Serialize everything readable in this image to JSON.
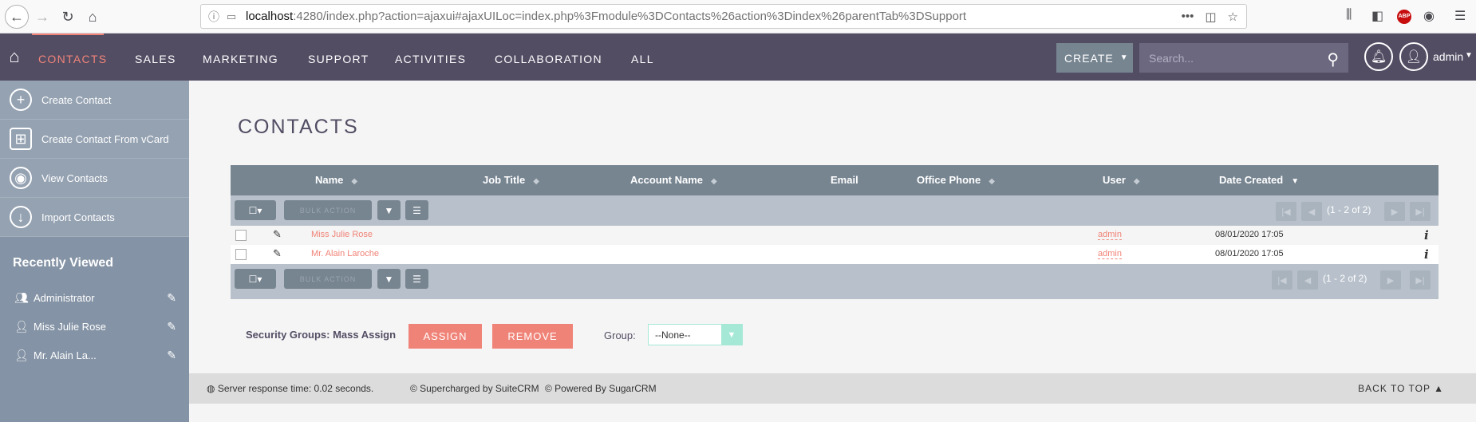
{
  "browser": {
    "url_host": "localhost",
    "url_rest": ":4280/index.php?action=ajaxui#ajaxUILoc=index.php%3Fmodule%3DContacts%26action%3Dindex%26parentTab%3DSupport",
    "more_label": "•••"
  },
  "nav": {
    "items": [
      "CONTACTS",
      "SALES",
      "MARKETING",
      "SUPPORT",
      "ACTIVITIES",
      "COLLABORATION",
      "ALL"
    ],
    "create_label": "CREATE",
    "search_placeholder": "Search...",
    "user_name": "admin",
    "active_color": "#f08377",
    "bar_color": "#534d64"
  },
  "sidebar": {
    "actions": [
      {
        "label": "Create Contact",
        "icon": "plus-icon"
      },
      {
        "label": "Create Contact From vCard",
        "icon": "vcard-icon"
      },
      {
        "label": "View Contacts",
        "icon": "eye-icon"
      },
      {
        "label": "Import Contacts",
        "icon": "import-icon"
      }
    ],
    "recent_title": "Recently Viewed",
    "recent": [
      {
        "label": "Administrator",
        "icon": "group-icon"
      },
      {
        "label": "Miss Julie Rose",
        "icon": "person-icon"
      },
      {
        "label": "Mr. Alain La...",
        "icon": "person-icon"
      }
    ]
  },
  "page": {
    "title": "CONTACTS"
  },
  "table": {
    "columns": [
      "Name",
      "Job Title",
      "Account Name",
      "Email",
      "Office Phone",
      "User",
      "Date Created"
    ],
    "bulk_action_label": "BULK ACTION",
    "pagination": "(1 - 2 of 2)",
    "rows": [
      {
        "name": "Miss Julie Rose",
        "user": "admin",
        "date_created": "08/01/2020 17:05"
      },
      {
        "name": "Mr. Alain Laroche",
        "user": "admin",
        "date_created": "08/01/2020 17:05"
      }
    ]
  },
  "security": {
    "label": "Security Groups: Mass Assign",
    "assign_label": "ASSIGN",
    "remove_label": "REMOVE",
    "group_label": "Group:",
    "group_value": "--None--"
  },
  "footer": {
    "response_time": "Server response time: 0.02 seconds.",
    "suitecrm": "© Supercharged by SuiteCRM",
    "sugarcrm": "© Powered By SugarCRM",
    "back_to_top": "BACK TO TOP"
  }
}
